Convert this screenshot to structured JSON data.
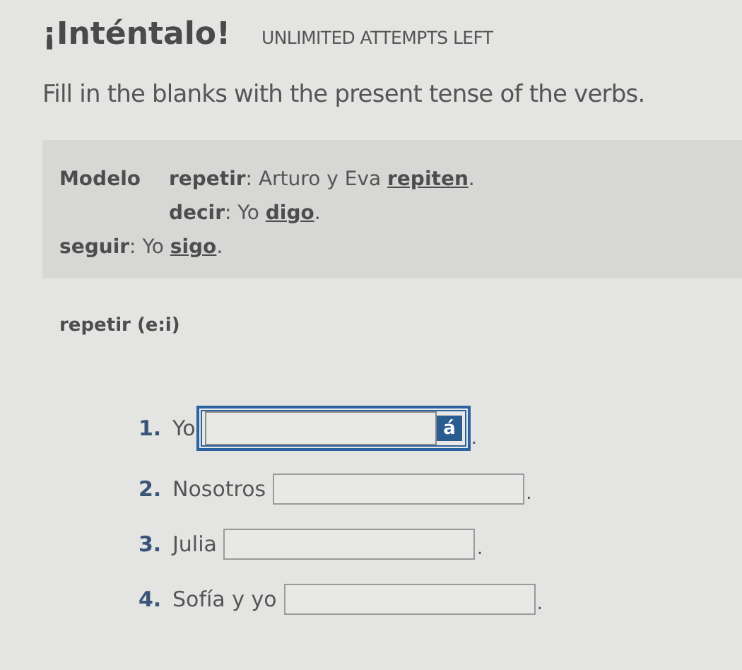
{
  "title": "¡Inténtalo!",
  "attempts": "UNLIMITED ATTEMPTS LEFT",
  "instruction": "Fill in the blanks with the present tense of the verbs.",
  "model": {
    "label": "Modelo",
    "lines": [
      {
        "verb": "repetir",
        "rest": ": Arturo y Eva ",
        "answer": "repiten",
        "end": "."
      },
      {
        "verb": "decir",
        "rest": ": Yo ",
        "answer": "digo",
        "end": "."
      }
    ],
    "extra": {
      "verb": "seguir",
      "rest": ": Yo ",
      "answer": "sigo",
      "end": "."
    }
  },
  "heading": "repetir (e:i)",
  "items": [
    {
      "number": "1.",
      "subject": "Yo",
      "focused": true,
      "accent": "á",
      "end": "."
    },
    {
      "number": "2.",
      "subject": "Nosotros",
      "focused": false,
      "end": "."
    },
    {
      "number": "3.",
      "subject": "Julia",
      "focused": false,
      "end": "."
    },
    {
      "number": "4.",
      "subject": "Sofía y yo",
      "focused": false,
      "end": "."
    }
  ]
}
